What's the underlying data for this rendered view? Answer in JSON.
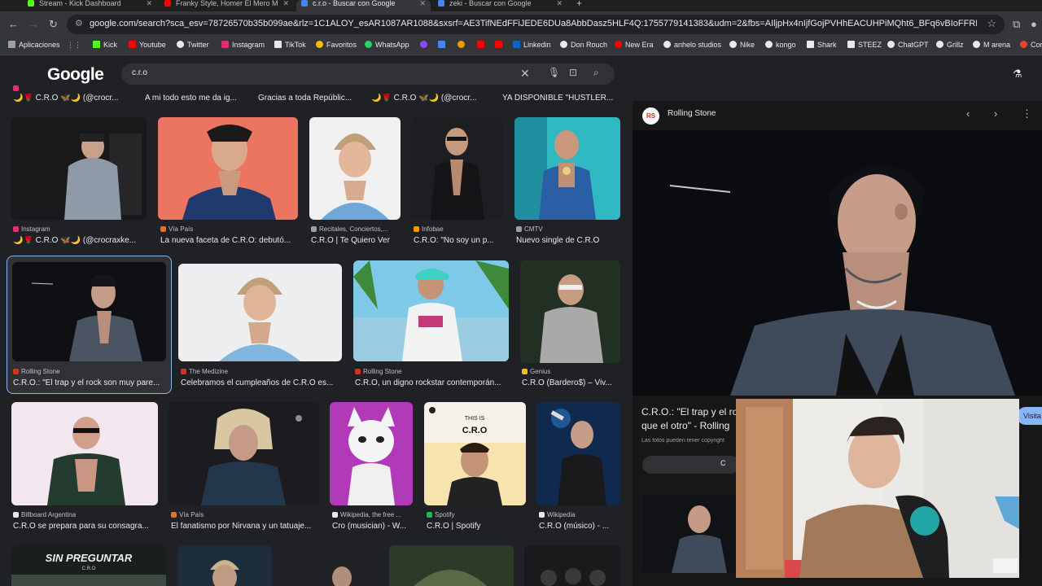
{
  "browser": {
    "tabs": [
      {
        "title": "Stream - Kick Dashboard",
        "color": "#53fc18"
      },
      {
        "title": "Franky Style, Homer El Mero M",
        "color": "#ff0000"
      },
      {
        "title": "c.r.o - Buscar con Google",
        "color": "#4285f4",
        "active": true
      },
      {
        "title": "zeki - Buscar con Google",
        "color": "#4285f4"
      }
    ],
    "url": "google.com/search?sca_esv=78726570b35b099ae&rlz=1C1ALOY_esAR1087AR1088&sxsrf=AE3TifNEdFFiJEDE6DUa8AbbDasz5HLF4Q:1755779141383&udm=2&fbs=AIljpHx4nIjfGojPVHhEACUHPiMQht6_BFq6vBIoFFRK7qchKEWEvuc0Hbw31oEI7c8o3y..."
  },
  "bookmarks": [
    {
      "label": "Aplicaciones",
      "color": "#9aa0a6"
    },
    {
      "label": "Kick",
      "color": "#53fc18"
    },
    {
      "label": "Youtube",
      "color": "#ff0000"
    },
    {
      "label": "Twitter",
      "color": "#e8eaed"
    },
    {
      "label": "Instagram",
      "color": "#e1306c"
    },
    {
      "label": "TikTok",
      "color": "#e8eaed"
    },
    {
      "label": "Favoritos",
      "color": "#fbbc04"
    },
    {
      "label": "WhatsApp",
      "color": "#25d366"
    },
    {
      "label": "Linkedin",
      "color": "#0a66c2"
    },
    {
      "label": "Don Rouch",
      "color": "#e8eaed"
    },
    {
      "label": "New Era",
      "color": "#ff0000"
    },
    {
      "label": "anhelo studios",
      "color": "#e8eaed"
    },
    {
      "label": "Nike",
      "color": "#e8eaed"
    },
    {
      "label": "kongo",
      "color": "#e8eaed"
    },
    {
      "label": "Shark",
      "color": "#e8eaed"
    },
    {
      "label": "STEEZ",
      "color": "#e8eaed"
    },
    {
      "label": "ChatGPT",
      "color": "#e8eaed"
    },
    {
      "label": "Grillz",
      "color": "#e8eaed"
    },
    {
      "label": "M arena",
      "color": "#e8eaed"
    },
    {
      "label": "Com",
      "color": "#ea4335"
    }
  ],
  "google": {
    "logo": "Google",
    "query": "c.r.o"
  },
  "results": {
    "row0": [
      {
        "caption": "🌙🌹 C.R.O 🦋🌙 (@crocr..."
      },
      {
        "caption": "A mi todo esto me da ig..."
      },
      {
        "caption": "Gracias a toda Repúblic..."
      },
      {
        "caption": "🌙🌹 C.R.O 🦋🌙 (@crocr..."
      },
      {
        "caption": "YA DISPONIBLE \"HUSTLER..."
      }
    ],
    "row1": [
      {
        "source": "Instagram",
        "caption": "🌙🌹 C.R.O 🦋🌙 (@crocraxke...",
        "color": "#e1306c"
      },
      {
        "source": "Vía País",
        "caption": "La nueva faceta de C.R.O: debutó...",
        "color": "#e8711a"
      },
      {
        "source": "Recitales, Conciertos,...",
        "caption": "C.R.O | Te Quiero Ver",
        "color": "#9aa0a6"
      },
      {
        "source": "Infobae",
        "caption": "C.R.O: \"No soy un p...",
        "color": "#f29900"
      },
      {
        "source": "CMTV",
        "caption": "Nuevo single de C.R.O",
        "color": "#9aa0a6"
      }
    ],
    "row2": [
      {
        "source": "Rolling Stone",
        "caption": "C.R.O.: \"El trap y el rock son muy pare...",
        "color": "#d93025"
      },
      {
        "source": "The Medizine",
        "caption": "Celebramos el cumpleaños de C.R.O es...",
        "color": "#d93025"
      },
      {
        "source": "Rolling Stone",
        "caption": "C.R.O, un digno rockstar contemporán...",
        "color": "#d93025"
      },
      {
        "source": "Genius",
        "caption": "C.R.O (Bardero$) – Viv...",
        "color": "#fbbc04"
      }
    ],
    "row3": [
      {
        "source": "Billboard Argentina",
        "caption": "C.R.O se prepara para su consagra...",
        "color": "#e8eaed"
      },
      {
        "source": "Vía País",
        "caption": "El fanatismo por Nirvana y un tatuaje...",
        "color": "#e8711a"
      },
      {
        "source": "Wikipedia, the free ...",
        "caption": "Cro (musician) - W...",
        "color": "#e8eaed"
      },
      {
        "source": "Spotify",
        "caption": "C.R.O | Spotify",
        "color": "#1db954"
      },
      {
        "source": "Wikipedia",
        "caption": "C.R.O (músico) - ...",
        "color": "#e8eaed"
      }
    ],
    "image_texts": {
      "cover_top": "THIS IS",
      "cover_name": "C.R.O",
      "album": "SIN PREGUNTAR",
      "album_sub": "C.R.O"
    }
  },
  "panel": {
    "source": "Rolling Stone",
    "badge": "RS",
    "title": "C.R.O.: \"El trap y el rock son muy parecidos, uno es hijo de otro\" que el otro\" - Rolling",
    "title_visible": "C.R.O.: \"El trap y el ro que el otro\" - Rolling",
    "note": "Las fotos pueden tener copyright",
    "visit_label": "Visita",
    "share_label": "C"
  }
}
